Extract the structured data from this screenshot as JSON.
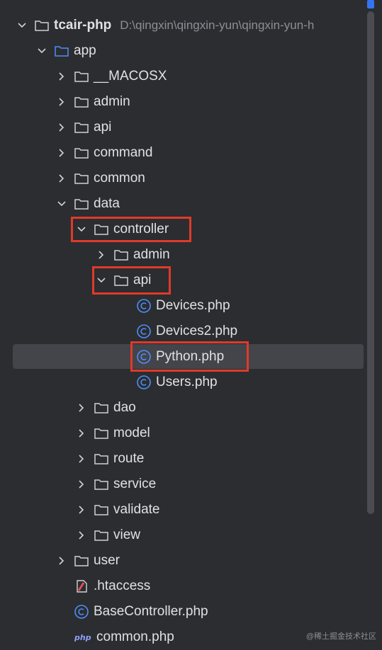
{
  "project": {
    "root_name": "tcair-php",
    "root_path": "D:\\qingxin\\qingxin-yun\\qingxin-yun-h"
  },
  "tree": [
    {
      "label": "app"
    },
    {
      "label": "__MACOSX"
    },
    {
      "label": "admin"
    },
    {
      "label": "api"
    },
    {
      "label": "command"
    },
    {
      "label": "common"
    },
    {
      "label": "data"
    },
    {
      "label": "controller"
    },
    {
      "label": "admin"
    },
    {
      "label": "api"
    },
    {
      "label": "Devices.php"
    },
    {
      "label": "Devices2.php"
    },
    {
      "label": "Python.php"
    },
    {
      "label": "Users.php"
    },
    {
      "label": "dao"
    },
    {
      "label": "model"
    },
    {
      "label": "route"
    },
    {
      "label": "service"
    },
    {
      "label": "validate"
    },
    {
      "label": "view"
    },
    {
      "label": "user"
    },
    {
      "label": ".htaccess"
    },
    {
      "label": "BaseController.php"
    },
    {
      "label": "common.php"
    }
  ],
  "watermark": "@稀土掘金技术社区",
  "icons": {
    "folder": "folder-icon",
    "class_file": "php-class-icon",
    "htaccess": "htaccess-file-icon",
    "php_file": "php-file-icon",
    "chevron_right": "chevron-right-icon",
    "chevron_down": "chevron-down-icon"
  },
  "colors": {
    "background": "#2b2d30",
    "selection": "#43454a",
    "highlight_box": "#e03a2a",
    "accent": "#3574f0",
    "text": "#dfe1e5",
    "muted": "#8c8f94"
  }
}
